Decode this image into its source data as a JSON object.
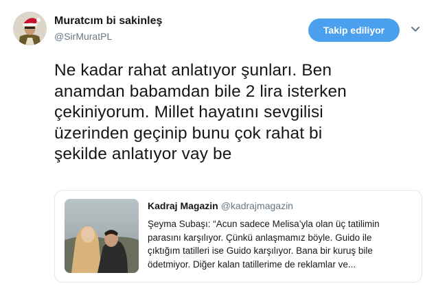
{
  "author": {
    "name": "Muratcım bi sakinleş",
    "handle": "@SirMuratPL",
    "avatar_icon": "santa-hat-avatar"
  },
  "follow_button": {
    "label": "Takip ediliyor"
  },
  "menu_icon": "chevron-down-icon",
  "tweet": {
    "lines": [
      "Ne kadar rahat anlatıyor şunları. Ben",
      "anamdan babamdan bile 2 lira isterken",
      "çekiniyorum. Millet hayatını sevgilisi",
      "üzerinden geçinip bunu çok rahat bi",
      "şekilde anlatıyor vay be"
    ]
  },
  "quote": {
    "name": "Kadraj Magazin",
    "handle": "@kadrajmagazin",
    "lines": [
      "Şeyma Subaşı: “Acun sadece Melisa’yla olan üç tatilimin",
      "parasını karşılıyor. Çünkü anlaşmamız böyle. Guido ile",
      "çıktığım tatilleri ise Guido karşılıyor. Bana bir kuruş bile",
      "ödetmiyor. Diğer kalan tatillerime de reklamlar ve..."
    ]
  },
  "colors": {
    "accent": "#4aa0ec",
    "secondary_text": "#657786",
    "border": "#e1e8ed"
  }
}
